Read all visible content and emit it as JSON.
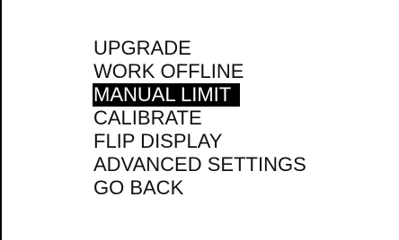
{
  "menu": {
    "items": [
      {
        "label": "UPGRADE",
        "selected": false
      },
      {
        "label": "WORK OFFLINE",
        "selected": false
      },
      {
        "label": "MANUAL LIMIT",
        "selected": true
      },
      {
        "label": "CALIBRATE",
        "selected": false
      },
      {
        "label": "FLIP DISPLAY",
        "selected": false
      },
      {
        "label": "ADVANCED SETTINGS",
        "selected": false
      },
      {
        "label": "GO BACK",
        "selected": false
      }
    ]
  },
  "colors": {
    "background": "#ffffff",
    "text": "#111111",
    "highlight_bg": "#000000",
    "highlight_text": "#ffffff"
  }
}
